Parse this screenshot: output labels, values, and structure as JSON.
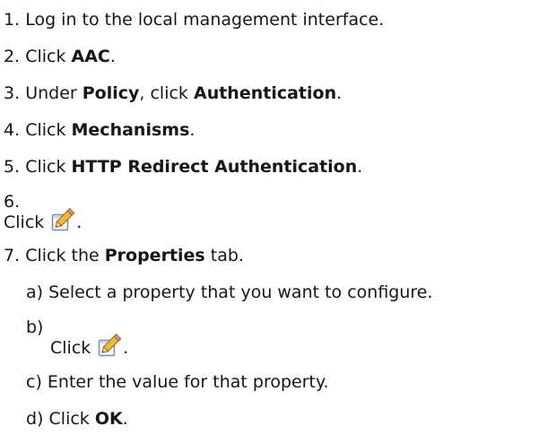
{
  "steps": [
    {
      "num": "1.",
      "parts": [
        {
          "t": "Log in to the local management interface.",
          "b": false
        }
      ]
    },
    {
      "num": "2.",
      "parts": [
        {
          "t": "Click ",
          "b": false
        },
        {
          "t": "AAC",
          "b": true
        },
        {
          "t": ".",
          "b": false
        }
      ]
    },
    {
      "num": "3.",
      "parts": [
        {
          "t": "Under ",
          "b": false
        },
        {
          "t": "Policy",
          "b": true
        },
        {
          "t": ", click ",
          "b": false
        },
        {
          "t": "Authentication",
          "b": true
        },
        {
          "t": ".",
          "b": false
        }
      ]
    },
    {
      "num": "4.",
      "parts": [
        {
          "t": "Click ",
          "b": false
        },
        {
          "t": "Mechanisms",
          "b": true
        },
        {
          "t": ".",
          "b": false
        }
      ]
    },
    {
      "num": "5.",
      "parts": [
        {
          "t": "Click ",
          "b": false
        },
        {
          "t": "HTTP Redirect Authentication",
          "b": true
        },
        {
          "t": ".",
          "b": false
        }
      ]
    },
    {
      "num": "6.",
      "click_text": "Click",
      "icon": "edit-pencil-icon",
      "after_icon": "."
    },
    {
      "num": "7.",
      "parts": [
        {
          "t": "Click the ",
          "b": false
        },
        {
          "t": "Properties",
          "b": true
        },
        {
          "t": " tab.",
          "b": false
        }
      ]
    }
  ],
  "substeps": [
    {
      "letter": "a)",
      "parts": [
        {
          "t": "Select a property that you want to configure.",
          "b": false
        }
      ]
    },
    {
      "letter": "b)",
      "click_text": "Click",
      "icon": "edit-pencil-icon",
      "after_icon": "."
    },
    {
      "letter": "c)",
      "parts": [
        {
          "t": "Enter the value for that property.",
          "b": false
        }
      ]
    },
    {
      "letter": "d)",
      "parts": [
        {
          "t": "Click ",
          "b": false
        },
        {
          "t": "OK",
          "b": true
        },
        {
          "t": ".",
          "b": false
        }
      ]
    }
  ]
}
